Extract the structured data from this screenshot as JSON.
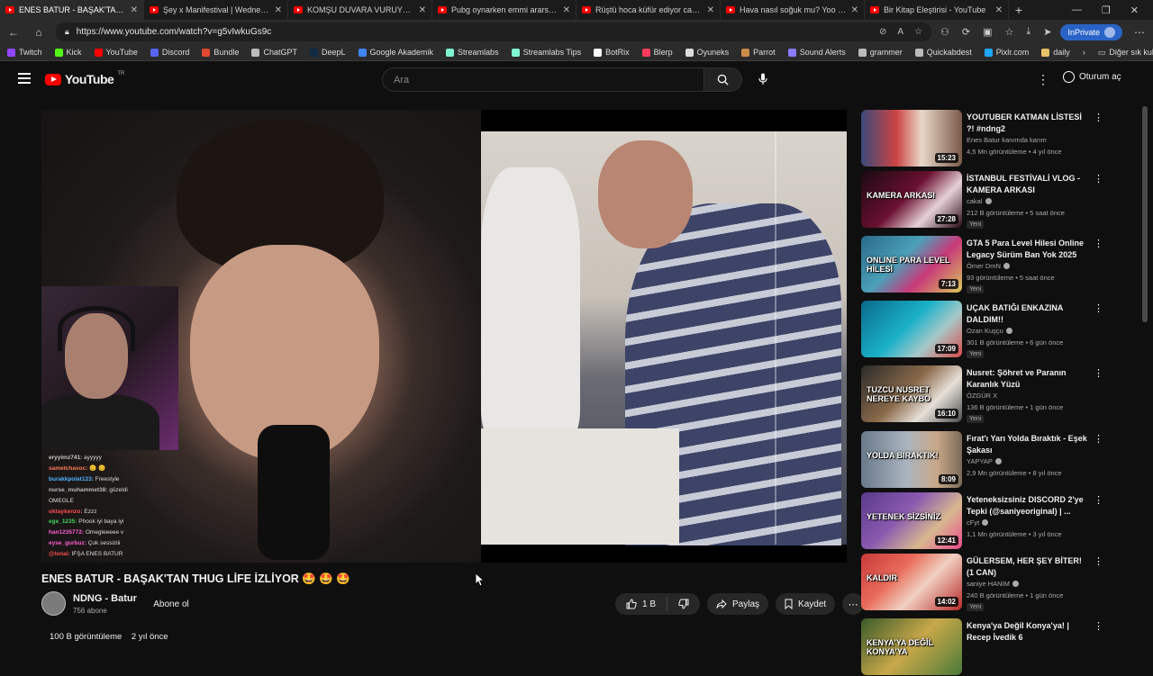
{
  "browser": {
    "tabs": [
      {
        "label": "ENES BATUR - BAŞAK'TAN TH",
        "active": true
      },
      {
        "label": "Şey x Manifestival | Wednesday |"
      },
      {
        "label": "KOMŞU DUVARA VURUYOR UNLU"
      },
      {
        "label": "Pubg oynarken emmi ararsa olur"
      },
      {
        "label": "Rüştü hoca küfür ediyor canlı yay"
      },
      {
        "label": "Hava nasıl soğuk mu? Yoo sıcak :"
      },
      {
        "label": "Bir Kitap Eleştirisi - YouTube"
      }
    ],
    "url": "https://www.youtube.com/watch?v=g5vIwkuGs9c",
    "inprivate_label": "InPrivate",
    "bookmarks": [
      {
        "label": "Twitch",
        "color": "#9146ff"
      },
      {
        "label": "Kick",
        "color": "#53fc18"
      },
      {
        "label": "YouTube",
        "color": "#ff0000"
      },
      {
        "label": "Discord",
        "color": "#5865f2"
      },
      {
        "label": "Bundle",
        "color": "#e0492f"
      },
      {
        "label": "ChatGPT",
        "color": "#bbbbbb"
      },
      {
        "label": "DeepL",
        "color": "#0f2b46"
      },
      {
        "label": "Google Akademik",
        "color": "#4285f4"
      },
      {
        "label": "Streamlabs",
        "color": "#80f5d2"
      },
      {
        "label": "Streamlabs Tips",
        "color": "#80f5d2"
      },
      {
        "label": "BotRix",
        "color": "#ffffff"
      },
      {
        "label": "Blerp",
        "color": "#ff3b5c"
      },
      {
        "label": "Oyuneks",
        "color": "#dddddd"
      },
      {
        "label": "Parrot",
        "color": "#c98b4a"
      },
      {
        "label": "Sound Alerts",
        "color": "#8a7cff"
      },
      {
        "label": "grammer",
        "color": "#bbbbbb"
      },
      {
        "label": "Quickabdest",
        "color": "#bbbbbb"
      },
      {
        "label": "Pixlr.com",
        "color": "#1ea7fd"
      },
      {
        "label": "daily",
        "color": "#e8c266"
      }
    ],
    "bookmarks_other": "Diğer sık kullanılanlar"
  },
  "header": {
    "logo_text": "YouTube",
    "logo_region": "TR",
    "search_placeholder": "Ara",
    "signin_label": "Oturum aç"
  },
  "player": {
    "chat": [
      {
        "user": "eryyimz741:",
        "msg": "ayyyyy",
        "color": "#c8c8c8"
      },
      {
        "user": "sametchavoc:",
        "msg": "😊 😊",
        "color": "#ff7a59"
      },
      {
        "user": "burakkpolat123:",
        "msg": "Freestyle",
        "color": "#4fb3ff"
      },
      {
        "user": "nurse_muhammet38:",
        "msg": "güzeldi",
        "color": "#b9b9b9"
      },
      {
        "user": "",
        "msg": "OMEGLE",
        "color": "#6a5cff"
      },
      {
        "user": "oktaykenzo:",
        "msg": "Ezzz",
        "color": "#ff4f4f"
      },
      {
        "user": "ege_1235:",
        "msg": "Phook iyi baya iyi",
        "color": "#45d35c"
      },
      {
        "user": "han1235772:",
        "msg": "Omegleeeee v",
        "color": "#ff5cd1"
      },
      {
        "user": "eyse_gurbuz:",
        "msg": "Çok sessiziii",
        "color": "#ff5cd1"
      },
      {
        "user": "@lonai:",
        "msg": "IFŞA ENES BATUR",
        "color": "#ff4f4f"
      }
    ]
  },
  "video": {
    "title": "ENES BATUR - BAŞAK'TAN THUG LİFE İZLİYOR 🤩 🤩 🤩",
    "channel_name": "NDNG - Batur",
    "subscribers": "756 abone",
    "subscribe_label": "Abone ol",
    "likes": "1 B",
    "share_label": "Paylaş",
    "save_label": "Kaydet",
    "views": "100 B görüntüleme",
    "date": "2 yıl önce"
  },
  "sidebar": {
    "items": [
      {
        "title": "YOUTUBER KATMAN LİSTESİ ?! #ndng2",
        "channel": "Enes Batur kanımda karım",
        "verified": false,
        "meta": "4,5 Mn görüntüleme • 4 yıl önce",
        "new": "",
        "duration": "15:23",
        "thumb_bg": "linear-gradient(90deg,#3a4a7a 0%,#c44 35%,#e8d8c8 60%,#7a5a4a 100%)"
      },
      {
        "title": "İSTANBUL FESTİVALİ VLOG - KAMERA ARKASI",
        "channel": "cakal",
        "verified": true,
        "meta": "212 B görüntüleme • 5 saat önce",
        "new": "Yeni",
        "duration": "27:28",
        "thumb_bg": "linear-gradient(135deg,#1a0a12 0%,#6a1030 45%,#e6d0d8 70%,#2a0a16 100%)"
      },
      {
        "title": "GTA 5 Para Level Hilesi Online Legacy Sürüm Ban Yok 2025",
        "channel": "Ömer DmN",
        "verified": true,
        "meta": "93 görüntüleme • 5 saat önce",
        "new": "Yeni",
        "duration": "7:13",
        "thumb_bg": "linear-gradient(135deg,#2a6a8a 0%,#4aa0b8 40%,#c83a7a 65%,#d8c85a 100%)"
      },
      {
        "title": "UÇAK BATIĞI ENKAZINA DALDIM!!",
        "channel": "Ozan Kuşçu",
        "verified": true,
        "meta": "301 B görüntüleme • 6 gün önce",
        "new": "Yeni",
        "duration": "17:09",
        "thumb_bg": "linear-gradient(135deg,#0a6a8a 0%,#1ab0c8 45%,#a8c8c8 70%,#d84a4a 100%)"
      },
      {
        "title": "Nusret: Şöhret ve Paranın Karanlık Yüzü",
        "channel": "ÖZGÜR X",
        "verified": false,
        "meta": "136 B görüntüleme • 1 gün önce",
        "new": "Yeni",
        "duration": "16:10",
        "thumb_bg": "linear-gradient(135deg,#2a2a2a 0%,#8a6a4a 45%,#e6e0d8 70%,#4a4a4a 100%)"
      },
      {
        "title": "Fırat'ı Yarı Yolda Bıraktık - Eşek Şakası",
        "channel": "YAPYAP",
        "verified": true,
        "meta": "2,9 Mn görüntüleme • 8 yıl önce",
        "new": "",
        "duration": "8:09",
        "thumb_bg": "linear-gradient(90deg,#6a7a8a 0%,#aab4c0 45%,#c8a888 75%,#7a6a5a 100%)"
      },
      {
        "title": "Yeteneksizsiniz DISCORD 2'ye Tepki (@saniyeoriginal) | ...",
        "channel": "cFyt",
        "verified": true,
        "meta": "1,1 Mn görüntüleme • 3 yıl önce",
        "new": "",
        "duration": "12:41",
        "thumb_bg": "linear-gradient(135deg,#5a3a8a 0%,#8a5ab0 40%,#d8b890 70%,#e84a8a 100%)"
      },
      {
        "title": "GÜLERSEM, HER ŞEY BİTER! (1 CAN)",
        "channel": "saniye HANIM",
        "verified": true,
        "meta": "240 B görüntüleme • 1 gün önce",
        "new": "Yeni",
        "duration": "14:02",
        "thumb_bg": "linear-gradient(135deg,#c83a3a 0%,#e86a5a 35%,#f0d0c0 60%,#b82a2a 100%)"
      },
      {
        "title": "Kenya'ya Değil Konya'ya! | Recep İvedik 6",
        "channel": "",
        "verified": false,
        "meta": "",
        "new": "",
        "duration": "",
        "thumb_bg": "linear-gradient(135deg,#3a5a2a 0%,#c8a84a 50%,#4a7a3a 100%)"
      }
    ],
    "thumb_texts": [
      "",
      "KAMERA ARKASI",
      "ONLINE PARA LEVEL HİLESİ",
      "",
      "TUZCU NUSRET NEREYE KAYBO",
      "YOLDA BIRAKTIK!",
      "YETENEK SİZSİNİZ",
      "KALDIR",
      "KENYA'YA DEĞİL KONYA'YA"
    ]
  }
}
